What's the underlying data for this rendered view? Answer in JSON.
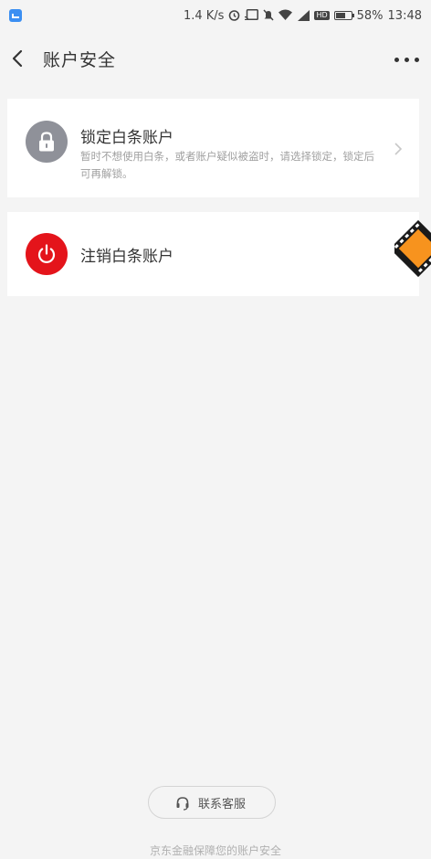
{
  "status_bar": {
    "network_speed": "1.4 K/s",
    "battery_percent": "58%",
    "time": "13:48",
    "hd_label": "HD",
    "icons": [
      "app-notification-icon",
      "alarm-icon",
      "cast-icon",
      "mute-icon",
      "wifi-icon",
      "signal-icon",
      "battery-icon"
    ]
  },
  "header": {
    "title": "账户安全",
    "back_icon": "chevron-left-icon",
    "more_icon": "more-horizontal-icon"
  },
  "cards": [
    {
      "title": "锁定白条账户",
      "description": "暂时不想使用白条，或者账户疑似被盗时，请选择锁定，锁定后可再解锁。",
      "icon": "lock-icon",
      "icon_color": "#8f9199"
    },
    {
      "title": "注销白条账户",
      "icon": "power-icon",
      "icon_color": "#e4141b"
    }
  ],
  "footer": {
    "contact_label": "联系客服",
    "contact_icon": "headset-icon",
    "note": "京东金融保障您的账户安全"
  }
}
